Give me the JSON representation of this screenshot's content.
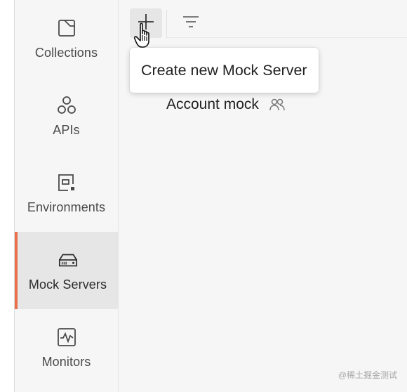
{
  "sidebar": {
    "items": [
      {
        "label": "Collections",
        "icon": "collections-icon",
        "active": false
      },
      {
        "label": "APIs",
        "icon": "apis-icon",
        "active": false
      },
      {
        "label": "Environments",
        "icon": "environments-icon",
        "active": false
      },
      {
        "label": "Mock Servers",
        "icon": "mock-servers-icon",
        "active": true
      },
      {
        "label": "Monitors",
        "icon": "monitors-icon",
        "active": false
      }
    ],
    "active_accent": "#e9704b"
  },
  "toolbar": {
    "add_icon": "plus-icon",
    "filter_icon": "filter-icon"
  },
  "tooltip": {
    "text": "Create new Mock Server"
  },
  "mock_list": [
    {
      "name": "Account mock",
      "shared_icon": "team-icon"
    }
  ],
  "watermark": {
    "text": "@稀土掘金测试"
  }
}
